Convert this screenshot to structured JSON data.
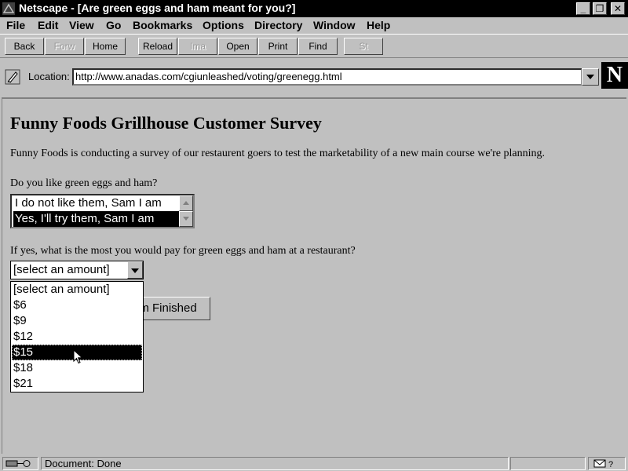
{
  "window": {
    "title": "Netscape - [Are green eggs and ham meant for you?]",
    "minimize_glyph": "_",
    "restore_glyph": "❐",
    "close_glyph": "✕"
  },
  "menu": {
    "items": [
      "File",
      "Edit",
      "View",
      "Go",
      "Bookmarks",
      "Options",
      "Directory",
      "Window",
      "Help"
    ]
  },
  "toolbar": {
    "buttons": [
      {
        "label": "Back",
        "enabled": true
      },
      {
        "label": "Forw",
        "enabled": false
      },
      {
        "label": "Home",
        "enabled": true
      },
      {
        "label": "Reload",
        "enabled": true
      },
      {
        "label": "Ima",
        "enabled": false
      },
      {
        "label": "Open",
        "enabled": true
      },
      {
        "label": "Print",
        "enabled": true
      },
      {
        "label": "Find",
        "enabled": true
      },
      {
        "label": "St",
        "enabled": false
      }
    ]
  },
  "location": {
    "label": "Location:",
    "url": "http://www.anadas.com/cgiunleashed/voting/greenegg.html"
  },
  "logo": {
    "letter": "N"
  },
  "page": {
    "heading": "Funny Foods Grillhouse Customer Survey",
    "intro": "Funny Foods is conducting a survey of our restaurent goers to test the marketability of a new main course we're planning.",
    "question1": "Do you like green eggs and ham?",
    "question1_options": [
      {
        "label": "I do not like them, Sam I am",
        "selected": false
      },
      {
        "label": "Yes, I'll try them, Sam I am",
        "selected": true
      }
    ],
    "question2": "If yes, what is the most you would pay for green eggs and ham at a restaurant?",
    "amount_select": {
      "value": "[select an amount]",
      "options": [
        "[select an amount]",
        "$6",
        "$9",
        "$12",
        "$15",
        "$18",
        "$21"
      ],
      "highlighted": "$15"
    },
    "submit_label": "I'm Finished"
  },
  "status": {
    "text": "Document: Done"
  },
  "colors": {
    "chrome": "#c0c0c0",
    "title_bar": "#000000",
    "selection": "#000000"
  }
}
